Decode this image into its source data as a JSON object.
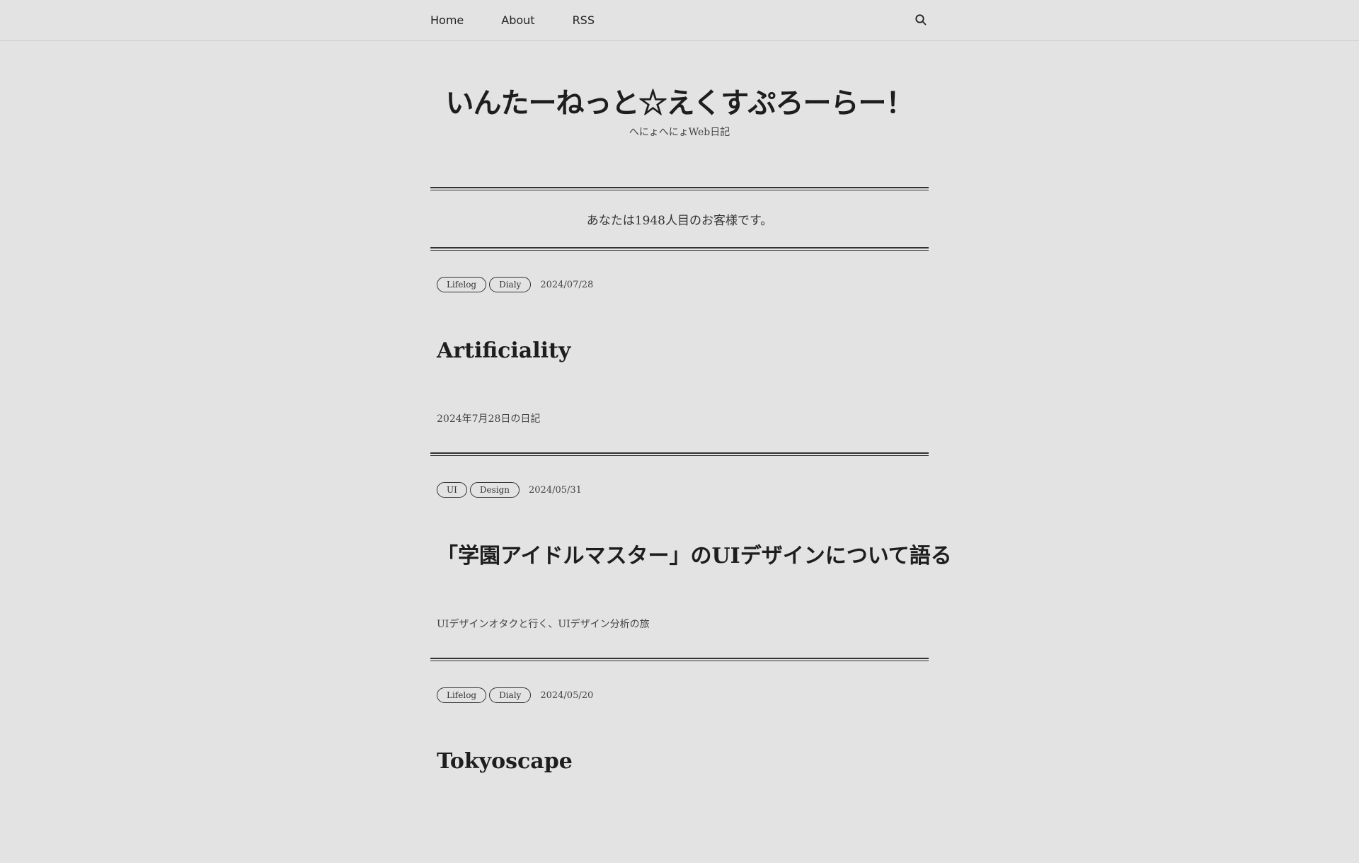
{
  "nav": {
    "links": [
      "Home",
      "About",
      "RSS"
    ],
    "search_icon": "search-icon"
  },
  "header": {
    "title": "いんたーねっと☆えくすぷろーらー！",
    "tagline": "へにょへにょWeb日記"
  },
  "counter": {
    "text": "あなたは1948人目のお客様です。"
  },
  "posts": [
    {
      "tags": [
        "Lifelog",
        "Dialy"
      ],
      "date": "2024/07/28",
      "title": "Artificiality",
      "excerpt": "2024年7月28日の日記"
    },
    {
      "tags": [
        "UI",
        "Design"
      ],
      "date": "2024/05/31",
      "title": "「学園アイドルマスター」のUIデザインについて語る",
      "excerpt": "UIデザインオタクと行く、UIデザイン分析の旅"
    },
    {
      "tags": [
        "Lifelog",
        "Dialy"
      ],
      "date": "2024/05/20",
      "title": "Tokyoscape",
      "excerpt": ""
    }
  ],
  "colors": {
    "background": "#e3e3e3",
    "text": "#2a2a2a",
    "rule": "#333333"
  }
}
